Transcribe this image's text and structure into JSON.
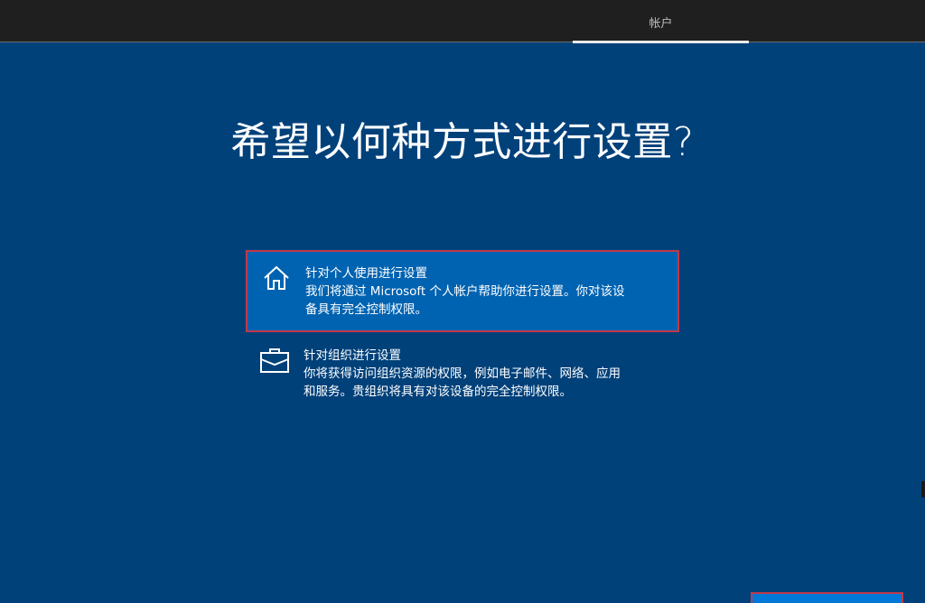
{
  "header": {
    "tabs": [
      {
        "label": "帐户",
        "active": true
      }
    ]
  },
  "main": {
    "title": "希望以何种方式进行设置?",
    "options": [
      {
        "title": "针对个人使用进行设置",
        "description_line1": "我们将通过 Microsoft 个人帐户帮助你进行设置。你对该设",
        "description_line2": "备具有完全控制权限。",
        "icon": "home-icon",
        "selected": true
      },
      {
        "title": "针对组织进行设置",
        "description_line1": "你将获得访问组织资源的权限，例如电子邮件、网络、应用",
        "description_line2": "和服务。贵组织将具有对该设备的完全控制权限。",
        "icon": "briefcase-icon",
        "selected": false
      }
    ]
  },
  "colors": {
    "background": "#00417a",
    "topbar": "#1f1f1f",
    "selected_option": "#0063b1",
    "focus_border": "#c0394a",
    "button": "#0078d7"
  }
}
